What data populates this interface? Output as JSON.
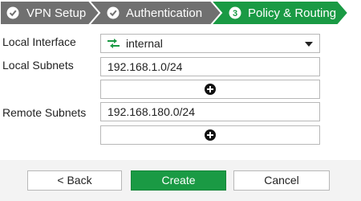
{
  "wizard": {
    "steps": [
      {
        "label": "VPN Setup",
        "state": "done",
        "icon": "check-circle-icon"
      },
      {
        "label": "Authentication",
        "state": "done",
        "icon": "check-circle-icon"
      },
      {
        "label": "Policy & Routing",
        "state": "current",
        "number": "3"
      }
    ],
    "colors": {
      "done": "#707070",
      "current": "#1a9a44",
      "separator": "#ffffff"
    }
  },
  "form": {
    "local_interface": {
      "label": "Local Interface",
      "value": "internal",
      "icon": "interface-arrows-icon"
    },
    "local_subnets": {
      "label": "Local Subnets",
      "value": "192.168.1.0/24"
    },
    "remote_subnets": {
      "label": "Remote Subnets",
      "value": "192.168.180.0/24"
    }
  },
  "footer": {
    "back_label": "< Back",
    "create_label": "Create",
    "cancel_label": "Cancel"
  }
}
